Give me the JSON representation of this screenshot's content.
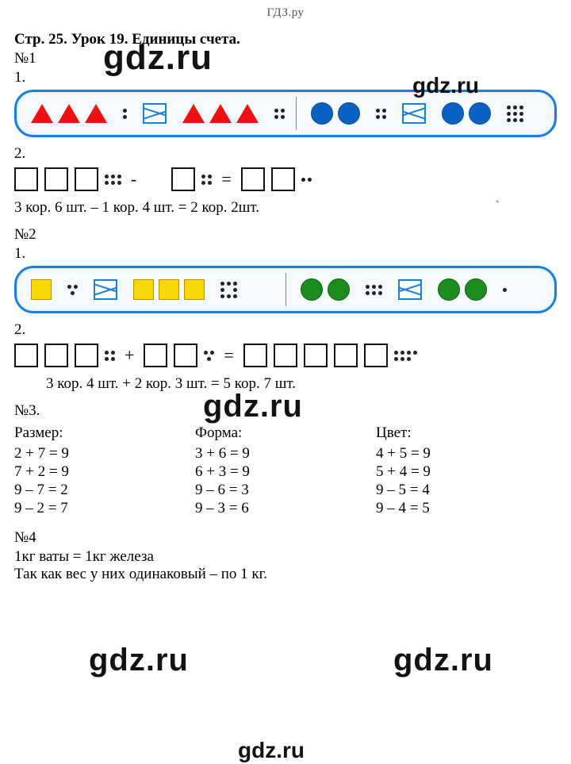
{
  "header": "ГДЗ.ру",
  "title": "Стр. 25. Урок 19. Единицы счета.",
  "watermark": "gdz.ru",
  "ex1": {
    "label": "№1",
    "p1": "1.",
    "p2": "2.",
    "answer": "3 кор. 6 шт.  – 1 кор. 4 шт. = 2 кор. 2шт."
  },
  "ex2": {
    "label": "№2",
    "p1": "1.",
    "p2": "2.",
    "answer": "3 кор. 4 шт. + 2 кор. 3 шт. = 5 кор. 7 шт."
  },
  "ex3": {
    "label": "№3.",
    "size_head": "Размер:",
    "size_eqs": [
      "2 + 7 = 9",
      "7 + 2 = 9",
      "9 – 7 = 2",
      "9 – 2 = 7"
    ],
    "shape_head": "Форма:",
    "shape_eqs": [
      "3 + 6 = 9",
      "6 + 3 = 9",
      "9 – 6 = 3",
      "9 – 3 = 6"
    ],
    "color_head": "Цвет:",
    "color_eqs": [
      "4 + 5 = 9",
      "5 + 4 = 9",
      "9 – 5 = 4",
      "9 – 4 = 5"
    ]
  },
  "ex4": {
    "label": "№4",
    "line1": "1кг ваты = 1кг железа",
    "line2": "Так как вес у них одинаковый – по 1 кг."
  },
  "ops": {
    "minus": "-",
    "plus": "+",
    "eq": "="
  }
}
